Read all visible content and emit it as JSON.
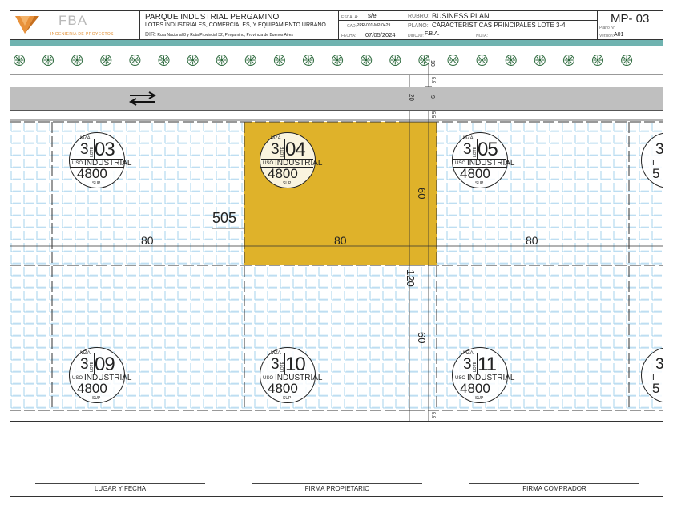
{
  "title_block": {
    "logo_name": "FBA",
    "logo_tagline": "INGENIERIA DE PROYECTOS",
    "project_title": "PARQUE INDUSTRIAL PERGAMINO",
    "project_subtitle": "LOTES INDUSTRIALES, COMERCIALES, Y EQUIPAMIENTO URBANO",
    "address_label": "DIR:",
    "address": "Ruta Nacional 8 y Ruta Provincial 32, Pergamino, Provincia de Buenos Aires",
    "escala_label": "ESCALA:",
    "escala_value": "s/e",
    "cad_label": "CAD:",
    "cad_value": "PPR-001-MP-0429",
    "fecha_label": "FECHA:",
    "fecha_value": "07/05/2024",
    "rubro_label": "RUBRO:",
    "rubro_value": "BUSINESS PLAN",
    "plano_label": "PLANO:",
    "plano_value": "CARACTERISTICAS PRINCIPALES LOTE 3-4",
    "dibujo_label": "DIBUJO:",
    "dibujo_value": "F.B.A.",
    "nota_label": "NOTA:",
    "plan_number": "MP- 03",
    "plan_number_label": "Plano N°",
    "version_label": "Version:",
    "version_value": "A01"
  },
  "plan": {
    "lots": [
      {
        "mza": "3",
        "lote": "03",
        "use": "INDUSTRIAL",
        "area": "4800"
      },
      {
        "mza": "3",
        "lote": "04",
        "use": "INDUSTRIAL",
        "area": "4800"
      },
      {
        "mza": "3",
        "lote": "05",
        "use": "INDUSTRIAL",
        "area": "4800"
      },
      {
        "mza": "3",
        "lote": "09",
        "use": "INDUSTRIAL",
        "area": "4800"
      },
      {
        "mza": "3",
        "lote": "10",
        "use": "INDUSTRIAL",
        "area": "4800"
      },
      {
        "mza": "3",
        "lote": "11",
        "use": "INDUSTRIAL",
        "area": "4800"
      }
    ],
    "cut_lots": [
      {
        "mza": "3",
        "use_partial": "I",
        "area_partial": "5"
      },
      {
        "mza": "3",
        "use_partial": "I",
        "area_partial": "5"
      }
    ],
    "badge_labels": {
      "mza": "MZA",
      "lote": "LOTE",
      "uso": "USO",
      "sup": "SUP"
    },
    "dimensions": {
      "lot_width_left": "80",
      "lot_width_center": "80",
      "lot_width_right": "80",
      "lot_depth_upper": "60",
      "lot_depth_lower": "60",
      "block_depth": "120",
      "level": "505",
      "road_width": "20",
      "road_lane": "9",
      "sidewalk_a": "5.5",
      "sidewalk_b": "5.5",
      "strip": "10",
      "bottom_setback": "5.5"
    },
    "highlight_color": "#dfb22a",
    "road_direction": "two-way"
  },
  "signatures": {
    "place_date": "LUGAR Y FECHA",
    "owner_signature": "FIRMA PROPIETARIO",
    "buyer_signature": "FIRMA COMPRADOR"
  }
}
